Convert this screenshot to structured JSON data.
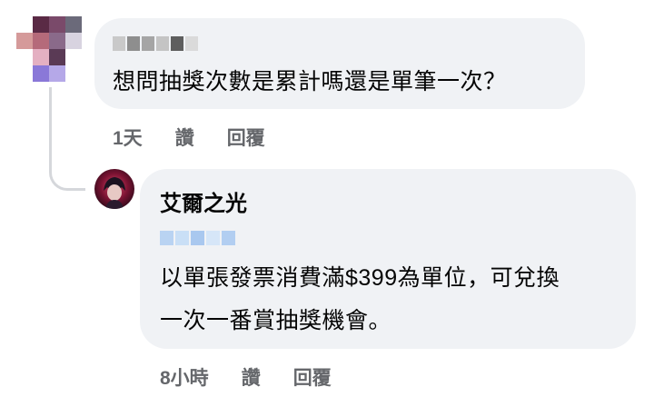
{
  "comments": [
    {
      "text": "想問抽獎次數是累計嗎還是單筆一次？",
      "time": "1天",
      "like_label": "讚",
      "reply_label": "回覆"
    }
  ],
  "reply": {
    "author": "艾爾之光",
    "text_line1": "以單張發票消費滿$399為單位，可兌換",
    "text_line2": "一次一番賞抽獎機會。",
    "time": "8小時",
    "like_label": "讚",
    "reply_label": "回覆"
  },
  "colors": {
    "bubble": "#f0f2f5",
    "meta_text": "#65676b",
    "thread_line": "#d5d7db"
  }
}
